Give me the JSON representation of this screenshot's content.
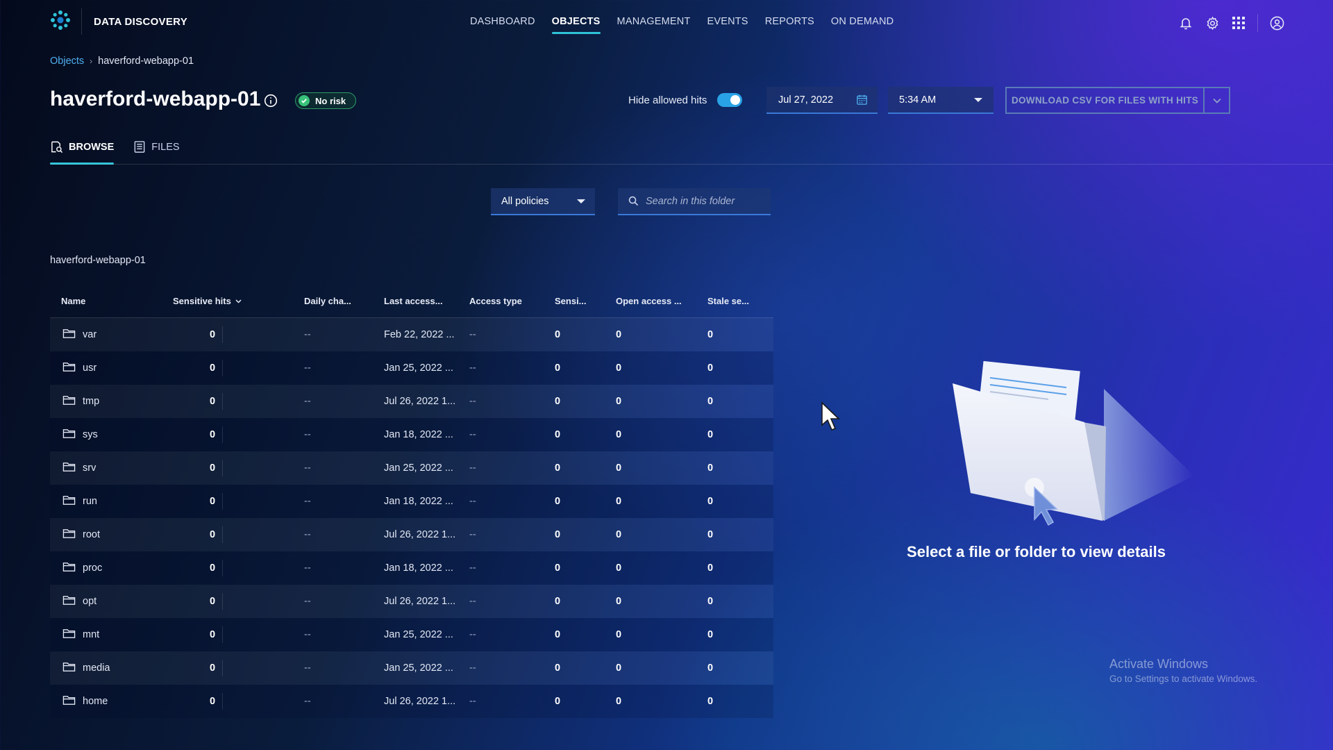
{
  "brand": "DATA DISCOVERY",
  "nav": [
    {
      "label": "DASHBOARD",
      "active": false
    },
    {
      "label": "OBJECTS",
      "active": true
    },
    {
      "label": "MANAGEMENT",
      "active": false
    },
    {
      "label": "EVENTS",
      "active": false
    },
    {
      "label": "REPORTS",
      "active": false
    },
    {
      "label": "ON DEMAND",
      "active": false
    }
  ],
  "breadcrumb": {
    "root": "Objects",
    "current": "haverford-webapp-01"
  },
  "title": "haverford-webapp-01",
  "risk_badge": "No risk",
  "toggle": {
    "label": "Hide allowed hits",
    "on": true
  },
  "date": "Jul 27, 2022",
  "time": "5:34 AM",
  "csv_button": "DOWNLOAD CSV FOR FILES WITH HITS",
  "tabs": [
    {
      "label": "BROWSE",
      "active": true
    },
    {
      "label": "FILES",
      "active": false
    }
  ],
  "filters": {
    "policy": "All policies",
    "search_placeholder": "Search in this folder"
  },
  "folder_path": "haverford-webapp-01",
  "table": {
    "columns": [
      "Name",
      "Sensitive hits",
      "Daily cha...",
      "Last access...",
      "Access type",
      "Sensi...",
      "Open access ...",
      "Stale se..."
    ],
    "rows": [
      {
        "name": "var",
        "hits": "0",
        "daily": "--",
        "last": "Feb 22, 2022 ...",
        "access": "--",
        "sensi": "0",
        "open": "0",
        "stale": "0"
      },
      {
        "name": "usr",
        "hits": "0",
        "daily": "--",
        "last": "Jan 25, 2022 ...",
        "access": "--",
        "sensi": "0",
        "open": "0",
        "stale": "0"
      },
      {
        "name": "tmp",
        "hits": "0",
        "daily": "--",
        "last": "Jul 26, 2022 1...",
        "access": "--",
        "sensi": "0",
        "open": "0",
        "stale": "0"
      },
      {
        "name": "sys",
        "hits": "0",
        "daily": "--",
        "last": "Jan 18, 2022 ...",
        "access": "--",
        "sensi": "0",
        "open": "0",
        "stale": "0"
      },
      {
        "name": "srv",
        "hits": "0",
        "daily": "--",
        "last": "Jan 25, 2022 ...",
        "access": "--",
        "sensi": "0",
        "open": "0",
        "stale": "0"
      },
      {
        "name": "run",
        "hits": "0",
        "daily": "--",
        "last": "Jan 18, 2022 ...",
        "access": "--",
        "sensi": "0",
        "open": "0",
        "stale": "0"
      },
      {
        "name": "root",
        "hits": "0",
        "daily": "--",
        "last": "Jul 26, 2022 1...",
        "access": "--",
        "sensi": "0",
        "open": "0",
        "stale": "0"
      },
      {
        "name": "proc",
        "hits": "0",
        "daily": "--",
        "last": "Jan 18, 2022 ...",
        "access": "--",
        "sensi": "0",
        "open": "0",
        "stale": "0"
      },
      {
        "name": "opt",
        "hits": "0",
        "daily": "--",
        "last": "Jul 26, 2022 1...",
        "access": "--",
        "sensi": "0",
        "open": "0",
        "stale": "0"
      },
      {
        "name": "mnt",
        "hits": "0",
        "daily": "--",
        "last": "Jan 25, 2022 ...",
        "access": "--",
        "sensi": "0",
        "open": "0",
        "stale": "0"
      },
      {
        "name": "media",
        "hits": "0",
        "daily": "--",
        "last": "Jan 25, 2022 ...",
        "access": "--",
        "sensi": "0",
        "open": "0",
        "stale": "0"
      },
      {
        "name": "home",
        "hits": "0",
        "daily": "--",
        "last": "Jul 26, 2022 1...",
        "access": "--",
        "sensi": "0",
        "open": "0",
        "stale": "0"
      }
    ]
  },
  "empty_message": "Select a file or folder to view details",
  "watermark": {
    "title": "Activate Windows",
    "subtitle": "Go to Settings to activate Windows."
  },
  "colors": {
    "accent": "#2fc3d8",
    "link": "#4fb0f0",
    "success": "#38c27a",
    "toggle": "#2aa3e6"
  }
}
